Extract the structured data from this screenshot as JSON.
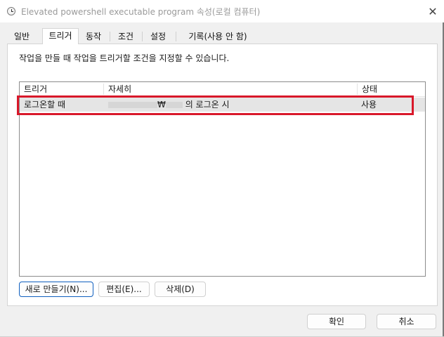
{
  "window": {
    "title": "Elevated powershell executable program 속성(로컬 컴퓨터)",
    "close_glyph": "✕"
  },
  "tabs": [
    {
      "label": "일반",
      "active": false
    },
    {
      "label": "트리거",
      "active": true
    },
    {
      "label": "동작",
      "active": false
    },
    {
      "label": "조건",
      "active": false
    },
    {
      "label": "설정",
      "active": false
    },
    {
      "label": "기록(사용 안 함)",
      "active": false
    }
  ],
  "panel": {
    "description": "작업을 만들 때 작업을 트리거할 조건을 지정할 수 있습니다."
  },
  "table": {
    "columns": [
      "트리거",
      "자세히",
      "상태"
    ],
    "rows": [
      {
        "trigger": "로그온할 때",
        "details_visible": "₩ 의 로그온 시",
        "details_sep": "₩",
        "details_suffix": "의 로그온 시",
        "status": "사용",
        "selected": true,
        "details_redacted": true
      }
    ]
  },
  "buttons": {
    "new": "새로 만들기(N)...",
    "edit": "편집(E)...",
    "delete": "삭제(D)",
    "ok": "확인",
    "cancel": "취소"
  },
  "colors": {
    "highlight_box": "#d9182a",
    "default_button_border": "#0f5fbf",
    "selected_row": "#e5e5e5"
  },
  "icons": {
    "title": "task-scheduler-clock-icon",
    "close": "close-icon"
  }
}
